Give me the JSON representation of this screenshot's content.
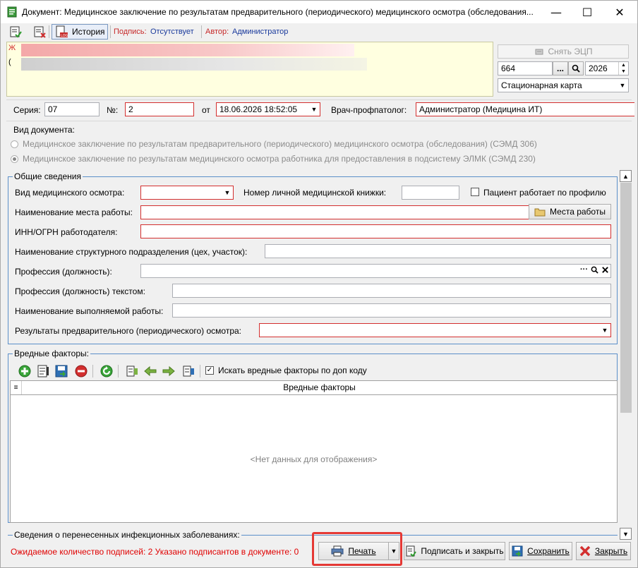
{
  "window": {
    "title": "Документ: Медицинское заключение по результатам предварительного (периодического) медицинского осмотра (обследования...",
    "minimize": "—",
    "maximize": "☐",
    "close": "✕"
  },
  "toolbar": {
    "history_label": "История",
    "signature_caption": "Подпись:",
    "signature_value": "Отсутствует",
    "author_caption": "Автор:",
    "author_value": "Администратор"
  },
  "patient_panel": {
    "remove_ecp_label": "Снять ЭЦП",
    "card_number": "664",
    "card_year": "2026",
    "card_type": "Стационарная карта",
    "browse_glyph": "...",
    "line1": "Ж",
    "line2": "("
  },
  "doc_header": {
    "series_label": "Серия:",
    "series_value": "07",
    "number_label": "№:",
    "number_value": "2",
    "from_label": "от",
    "date_value": "18.06.2026 18:52:05",
    "doctor_label": "Врач-профпатолог:",
    "doctor_value": "Администратор (Медицина ИТ)"
  },
  "doc_type": {
    "label": "Вид документа:",
    "option1": "Медицинское заключение по результатам предварительного (периодического) медицинского осмотра (обследования) (СЭМД 306)",
    "option2": "Медицинское заключение по результатам медицинского осмотра работника для предоставления в подсистему ЭЛМК (СЭМД 230)",
    "selected": "option2"
  },
  "general": {
    "title": "Общие сведения",
    "exam_type_label": "Вид медицинского осмотра:",
    "exam_type_value": "",
    "med_book_label": "Номер личной медицинской книжки:",
    "med_book_value": "",
    "works_by_profile_label": "Пациент работает по профилю",
    "workplace_label": "Наименование места работы:",
    "workplace_value": "",
    "workplaces_button": "Места работы",
    "inn_label": "ИНН/ОГРН работодателя:",
    "inn_value": "",
    "subdivision_label": "Наименование структурного подразделения (цех, участок):",
    "subdivision_value": "",
    "profession_label": "Профессия (должность):",
    "profession_value": "",
    "profession_text_label": "Профессия (должность) текстом:",
    "profession_text_value": "",
    "work_name_label": "Наименование выполняемой работы:",
    "work_name_value": "",
    "results_label": "Результаты предварительного (периодического) осмотра:",
    "results_value": ""
  },
  "harmful": {
    "title": "Вредные факторы:",
    "search_by_code_label": "Искать вредные факторы по доп коду",
    "search_by_code_checked": true,
    "column_header": "Вредные факторы",
    "empty_text": "<Нет данных для отображения>"
  },
  "infections": {
    "title": "Сведения о перенесенных инфекционных заболеваниях:"
  },
  "footer": {
    "status_text": "Ожидаемое количество подписей: 2 Указано подписантов в документе: 0",
    "print_label": "Печать",
    "sign_close_label": "Подписать и закрыть",
    "save_label": "Сохранить",
    "close_label": "Закрыть"
  },
  "colors": {
    "accent_blue": "#5b8fc9",
    "required_red": "#d32f2f",
    "status_red": "#e00000",
    "highlight": "#e53935"
  }
}
